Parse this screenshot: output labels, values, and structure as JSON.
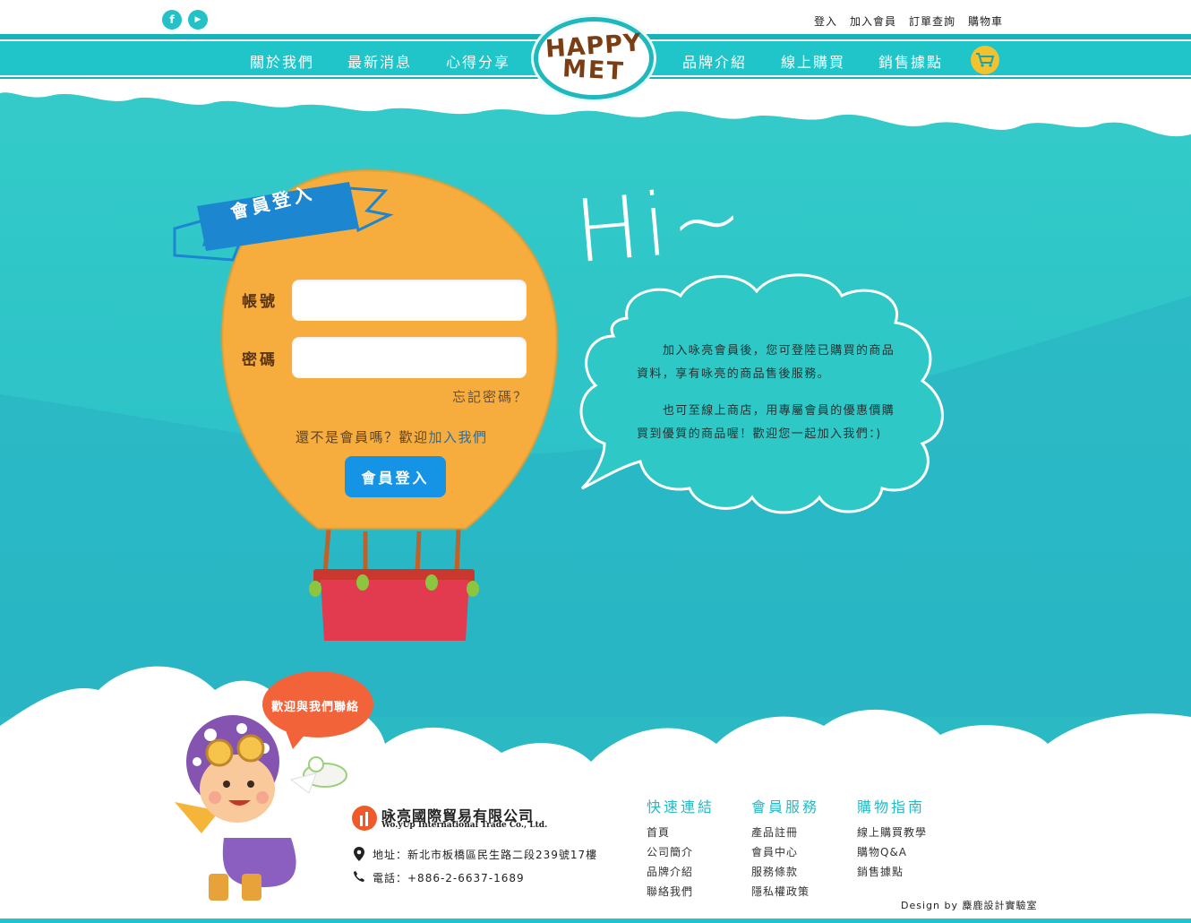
{
  "header": {
    "social": [
      {
        "name": "facebook-icon",
        "glyph": "f"
      },
      {
        "name": "youtube-icon",
        "glyph": "▶"
      }
    ],
    "top_links": [
      "登入",
      "加入會員",
      "訂單查詢",
      "購物車"
    ],
    "nav_left": [
      "關於我們",
      "最新消息",
      "心得分享"
    ],
    "nav_right": [
      "品牌介紹",
      "線上購買",
      "銷售據點"
    ],
    "logo_line1": "HAPPY",
    "logo_line2": "MET"
  },
  "login": {
    "ribbon": "會員登入",
    "account_label": "帳號",
    "password_label": "密碼",
    "account_value": "",
    "password_value": "",
    "forgot": "忘記密碼？",
    "not_member": "還不是會員嗎？歡迎",
    "join_link": "加入我們",
    "submit": "會員登入"
  },
  "greeting": {
    "hi": "Hi~",
    "p1_line1": "加入咏亮會員後，您可登陸已購買的商品",
    "p1_line2": "資料，享有咏亮的商品售後服務。",
    "p2_line1": "也可至線上商店，用專屬會員的優惠價購",
    "p2_line2": "買到優質的商品喔！歡迎您一起加入我們：)"
  },
  "contact_bubble": "歡迎與我們聯絡",
  "footer": {
    "company_name": "咏亮國際貿易有限公司",
    "company_en": "Wo.yUp International Trade Co., Ltd.",
    "address": "地址：新北市板橋區民生路二段239號17樓",
    "phone": "電話：+886-2-6637-1689",
    "columns": [
      {
        "title": "快速連結",
        "links": [
          "首頁",
          "公司簡介",
          "品牌介紹",
          "聯絡我們"
        ]
      },
      {
        "title": "會員服務",
        "links": [
          "產品註冊",
          "會員中心",
          "服務條款",
          "隱私權政策"
        ]
      },
      {
        "title": "購物指南",
        "links": [
          "線上購買教學",
          "購物Q&A",
          "銷售據點"
        ]
      }
    ],
    "credit": "Design by 麋鹿設計實驗室"
  },
  "colors": {
    "teal": "#1fc5c8",
    "sky": "#2ec8c6",
    "sky_dark": "#1ca9b6",
    "balloon": "#f6ad3e",
    "basket": "#e23a4f",
    "button": "#1594e6",
    "ribbon": "#1d86d0",
    "contact_bubble": "#f2633a"
  }
}
